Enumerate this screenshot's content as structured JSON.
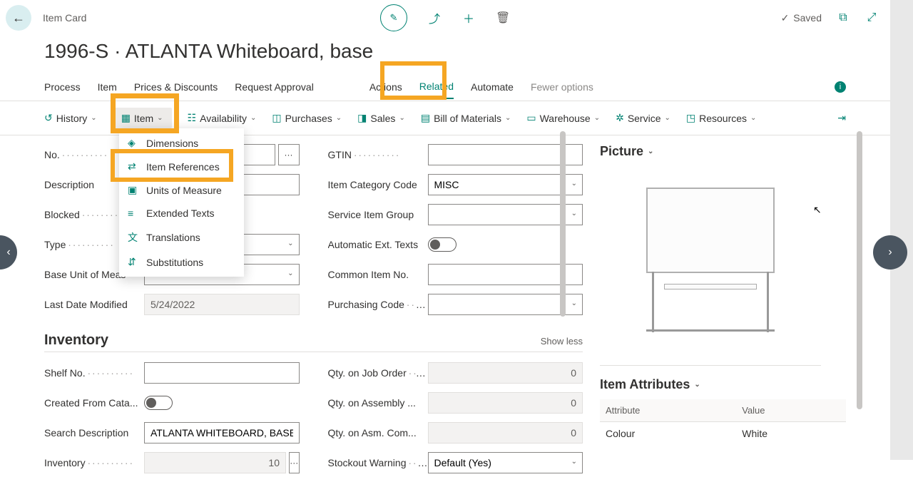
{
  "header": {
    "card_title": "Item Card",
    "page_title": "1996-S · ATLANTA Whiteboard, base",
    "saved_label": "Saved"
  },
  "nav": [
    "Process",
    "Item",
    "Prices & Discounts",
    "Request Approval",
    "Actions",
    "Related",
    "Automate",
    "Fewer options"
  ],
  "actions": [
    {
      "icon": "↺",
      "label": "History"
    },
    {
      "icon": "▦",
      "label": "Item"
    },
    {
      "icon": "☷",
      "label": "Availability"
    },
    {
      "icon": "◫",
      "label": "Purchases"
    },
    {
      "icon": "◨",
      "label": "Sales"
    },
    {
      "icon": "▤",
      "label": "Bill of Materials"
    },
    {
      "icon": "▭",
      "label": "Warehouse"
    },
    {
      "icon": "✲",
      "label": "Service"
    },
    {
      "icon": "◳",
      "label": "Resources"
    }
  ],
  "dropdown": [
    {
      "icon": "◈",
      "label": "Dimensions"
    },
    {
      "icon": "⇄",
      "label": "Item References"
    },
    {
      "icon": "▣",
      "label": "Units of Measure"
    },
    {
      "icon": "≡",
      "label": "Extended Texts"
    },
    {
      "icon": "文",
      "label": "Translations"
    },
    {
      "icon": "⇵",
      "label": "Substitutions"
    }
  ],
  "fields": {
    "no_label": "No.",
    "gtin_label": "GTIN",
    "desc_label": "Description",
    "desc_value": ", base",
    "cat_label": "Item Category Code",
    "cat_value": "MISC",
    "blocked_label": "Blocked",
    "sig_label": "Service Item Group",
    "type_label": "Type",
    "auto_label": "Automatic Ext. Texts",
    "base_label": "Base Unit of Meas",
    "common_label": "Common Item No.",
    "last_label": "Last Date Modified",
    "last_value": "5/24/2022",
    "purch_label": "Purchasing Code"
  },
  "inventory": {
    "title": "Inventory",
    "show_less": "Show less",
    "shelf_label": "Shelf No.",
    "qjob_label": "Qty. on Job Order",
    "qjob_value": "0",
    "cata_label": "Created From Cata...",
    "qasm_label": "Qty. on Assembly ...",
    "qasm_value": "0",
    "search_label": "Search Description",
    "search_value": "ATLANTA WHITEBOARD, BASE",
    "qcom_label": "Qty. on Asm. Com...",
    "qcom_value": "0",
    "inv_label": "Inventory",
    "inv_value": "10",
    "stock_label": "Stockout Warning",
    "stock_value": "Default (Yes)"
  },
  "picture": {
    "title": "Picture"
  },
  "attributes": {
    "title": "Item Attributes",
    "col1": "Attribute",
    "col2": "Value",
    "rows": [
      {
        "attr": "Colour",
        "val": "White"
      }
    ]
  }
}
